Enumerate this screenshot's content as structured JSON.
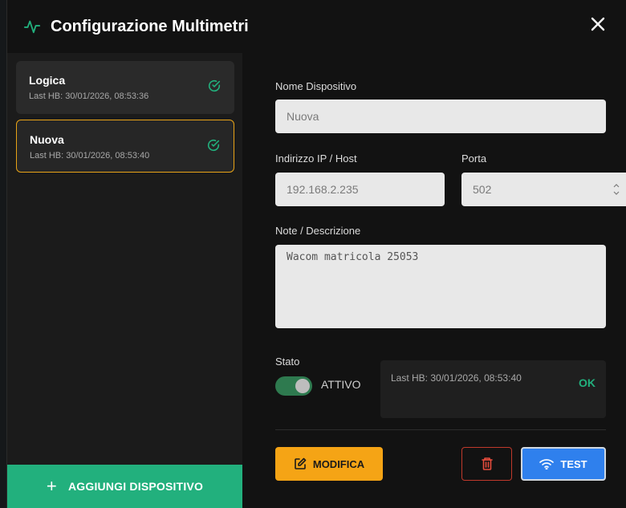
{
  "dialog": {
    "title": "Configurazione Multimetri",
    "title_icon": "activity-pulse-icon",
    "close_icon": "close-icon"
  },
  "devices": [
    {
      "name": "Logica",
      "last_hb": "Last HB: 30/01/2026, 08:53:36",
      "selected": false,
      "status_icon": "check-circle-icon"
    },
    {
      "name": "Nuova",
      "last_hb": "Last HB: 30/01/2026, 08:53:40",
      "selected": true,
      "status_icon": "check-circle-icon"
    }
  ],
  "sidebar": {
    "add_button_label": "AGGIUNGI DISPOSITIVO"
  },
  "form": {
    "name_label": "Nome Dispositivo",
    "name_value": "Nuova",
    "ip_label": "Indirizzo IP / Host",
    "ip_value": "192.168.2.235",
    "port_label": "Porta",
    "port_value": "502",
    "notes_label": "Note / Descrizione",
    "notes_value": "Wacom matricola 25053",
    "status_label": "Stato",
    "toggle_label": "ATTIVO",
    "toggle_on": true,
    "status_hb": "Last HB: 30/01/2026, 08:53:40",
    "status_ok": "OK"
  },
  "actions": {
    "edit_label": "MODIFICA",
    "test_label": "TEST"
  },
  "colors": {
    "accent_green": "#22b07d",
    "accent_orange": "#f5a415",
    "accent_blue": "#2f80ed",
    "danger_red": "#c0392b"
  }
}
